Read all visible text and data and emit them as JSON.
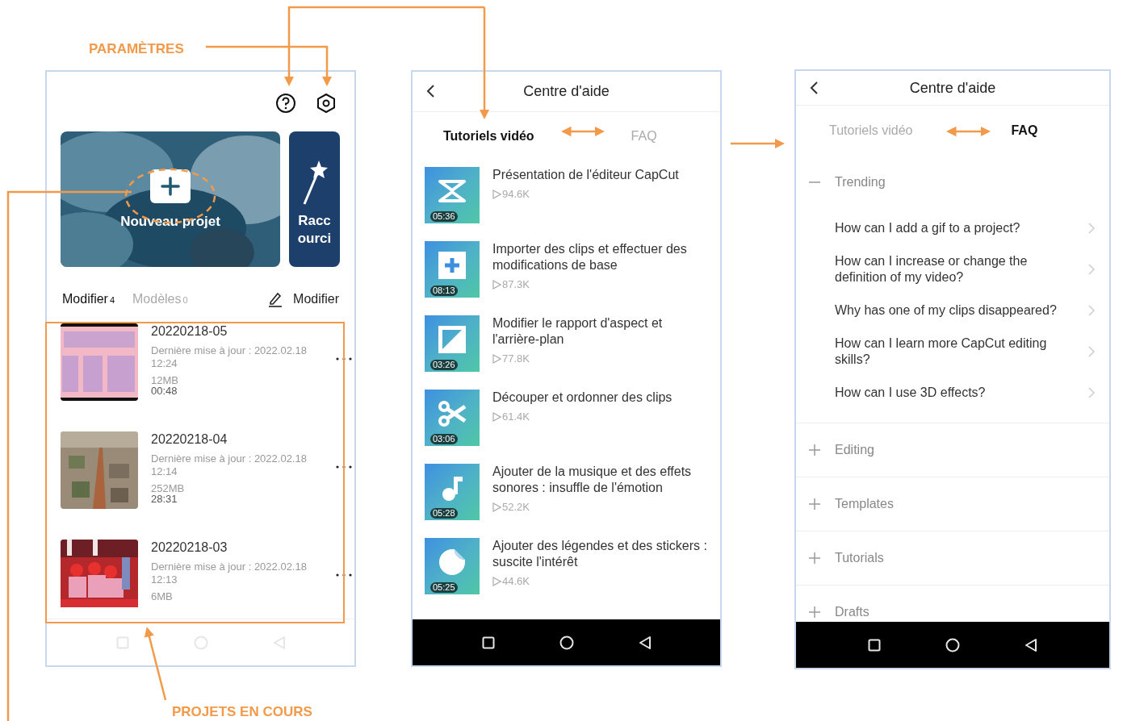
{
  "annotations": [
    {
      "text": "PARAMÈTRES"
    },
    {
      "text": "PROJETS EN COURS"
    }
  ],
  "home": {
    "new_project": "Nouveau projet",
    "shortcut": "Raccourci",
    "tabs": [
      {
        "label": "Modifier",
        "count": "4",
        "selected": true
      },
      {
        "label": "Modèles",
        "count": "0",
        "selected": false
      }
    ],
    "edit_button": "Modifier",
    "projects": [
      {
        "name": "20220218-05",
        "updated": "Dernière mise à jour : 2022.02.18 12:24",
        "size": "12MB",
        "duration": "00:48",
        "kind": "poster"
      },
      {
        "name": "20220218-04",
        "updated": "Dernière mise à jour : 2022.02.18 12:14",
        "size": "252MB",
        "duration": "28:31",
        "kind": "city"
      },
      {
        "name": "20220218-03",
        "updated": "Dernière mise à jour : 2022.02.18 12:13",
        "size": "6MB",
        "kind": "crowd"
      }
    ],
    "nav_bar": {
      "kind": "light"
    }
  },
  "tutorials": {
    "title": "Centre d'aide",
    "tabs": [
      {
        "label": "Tutoriels vidéo",
        "selected": true
      },
      {
        "label": "FAQ",
        "selected": false
      }
    ],
    "videos": [
      {
        "kind": "logo",
        "duration": "05:36",
        "title": "Présentation de l'éditeur CapCut",
        "views": "94.6K"
      },
      {
        "kind": "plus",
        "duration": "08:13",
        "title": "Importer des clips et effectuer des modifications de base",
        "views": "87.3K"
      },
      {
        "kind": "aspect",
        "duration": "03:26",
        "title": "Modifier le rapport d'aspect et l'arrière-plan",
        "views": "77.8K"
      },
      {
        "kind": "scissors",
        "duration": "03:06",
        "title": "Découper et ordonner des clips",
        "views": "61.4K"
      },
      {
        "kind": "music",
        "duration": "05:28",
        "title": "Ajouter de la musique et des effets sonores : insuffle de l'émotion",
        "views": "52.2K"
      },
      {
        "kind": "sticker",
        "duration": "05:25",
        "title": "Ajouter des légendes et des stickers : suscite l'intérêt",
        "views": "44.6K"
      }
    ],
    "nav_bar": {
      "kind": "dark"
    }
  },
  "faq": {
    "title": "Centre d'aide",
    "tabs": [
      {
        "label": "Tutoriels vidéo",
        "selected": false
      },
      {
        "label": "FAQ",
        "selected": true
      }
    ],
    "sections": [
      {
        "title": "Trending",
        "expanded": true,
        "questions": [
          "How can I add a gif to a project?",
          "How can I increase or change the definition of my video?",
          "Why has one of my clips disappeared?",
          "How can I learn more CapCut editing skills?",
          "How can I use 3D effects?"
        ]
      },
      {
        "title": "Editing",
        "expanded": false
      },
      {
        "title": "Templates",
        "expanded": false
      },
      {
        "title": "Tutorials",
        "expanded": false
      },
      {
        "title": "Drafts",
        "expanded": false
      }
    ],
    "nav_bar": {
      "kind": "dark"
    }
  }
}
